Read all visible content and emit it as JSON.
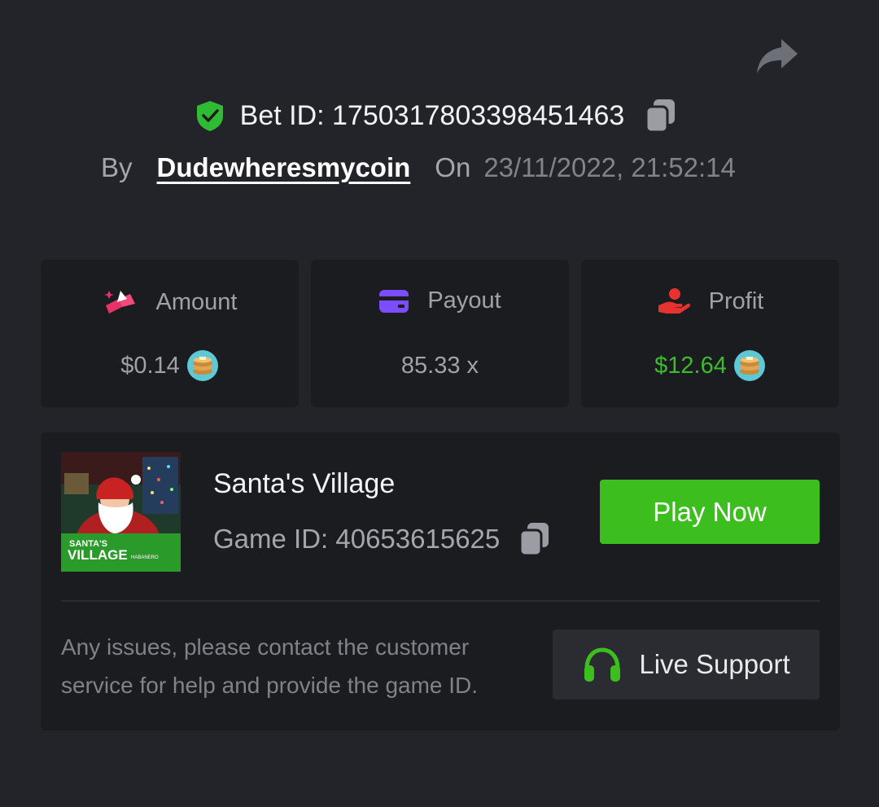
{
  "header": {
    "bet_id_label": "Bet ID: 1750317803398451463",
    "by_label": "By",
    "username": "Dudewheresmycoin",
    "on_label": "On",
    "datetime": "23/11/2022, 21:52:14"
  },
  "stats": [
    {
      "label": "Amount",
      "value": "$0.14",
      "icon": "bet-amount-icon",
      "color": "#9fa2a8"
    },
    {
      "label": "Payout",
      "value": "85.33 x",
      "icon": "wallet-card-icon",
      "color": "#9fa2a8"
    },
    {
      "label": "Profit",
      "value": "$12.64",
      "icon": "hand-coin-icon",
      "color": "#3dbb2c"
    }
  ],
  "game": {
    "title": "Santa's Village",
    "game_id_label": "Game ID: 40653615625",
    "thumbnail_text": "SANTA'S VILLAGE",
    "provider": "HABANERO",
    "play_label": "Play Now"
  },
  "support": {
    "help_text": "Any issues, please contact the customer service for help and provide the game ID.",
    "button_label": "Live Support"
  },
  "colors": {
    "background": "#232429",
    "card": "#1b1c20",
    "accent_green": "#3cbe1f",
    "profit_green": "#3dbb2c"
  }
}
